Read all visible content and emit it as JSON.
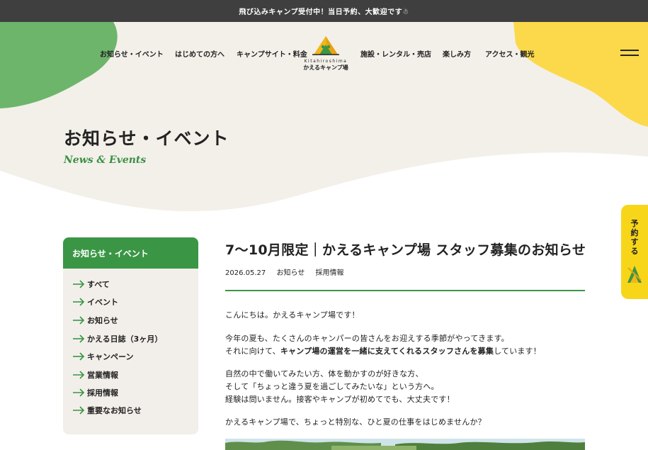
{
  "announcement": "飛び込みキャンプ受付中！当日予約、大歓迎です☃",
  "nav": {
    "left": [
      "お知らせ・イベント",
      "はじめての方へ",
      "キャンプサイト・料金"
    ],
    "right": [
      "施設・レンタル・売店",
      "楽しみ方",
      "アクセス・観光"
    ]
  },
  "logo": {
    "en": "Kitahiroshima",
    "jp": "かえるキャンプ場"
  },
  "page": {
    "title": "お知らせ・イベント",
    "subtitle": "News & Events"
  },
  "sidebar": {
    "heading": "お知らせ・イベント",
    "items": [
      "すべて",
      "イベント",
      "お知らせ",
      "かえる日誌（3ヶ月）",
      "キャンペーン",
      "営業情報",
      "採用情報",
      "重要なお知らせ"
    ]
  },
  "article": {
    "title": "7〜10月限定｜かえるキャンプ場 スタッフ募集のお知らせ",
    "date": "2026.05.27",
    "categories": [
      "お知らせ",
      "採用情報"
    ],
    "p1": "こんにちは。かえるキャンプ場です！",
    "p2_line1": "今年の夏も、たくさんのキャンパーの皆さんをお迎えする季節がやってきます。",
    "p2_line2_pre": "それに向けて、",
    "p2_line2_bold": "キャンプ場の運営を一緒に支えてくれるスタッフさんを募集",
    "p2_line2_post": "しています！",
    "p3_line1": "自然の中で働いてみたい方、体を動かすのが好きな方、",
    "p3_line2": "そして「ちょっと違う夏を過ごしてみたいな」という方へ。",
    "p3_line3": "経験は問いません。接客やキャンプが初めてでも、大丈夫です！",
    "p4": "かえるキャンプ場で、ちょっと特別な、ひと夏の仕事をはじめませんか？"
  },
  "reserve_button": "予約する",
  "colors": {
    "accent_green": "#3a9645",
    "blob_green": "#6db56a",
    "blob_yellow": "#fcd94a",
    "cream": "#f3f0ea",
    "topbar": "#3f3f3f"
  }
}
